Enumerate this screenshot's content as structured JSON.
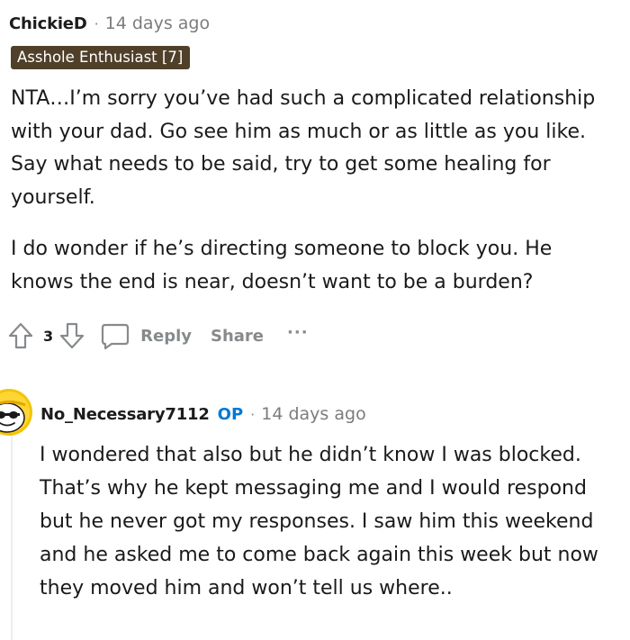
{
  "comment": {
    "username": "ChickieD",
    "separator": "·",
    "timestamp": "14 days ago",
    "flair": "Asshole Enthusiast [7]",
    "paragraphs": [
      "NTA…I’m sorry you’ve had such a complicated relationship with your dad. Go see him as much or as little as you like. Say what needs to be said, try to get some healing for yourself.",
      "I do wonder if he’s directing someone to block you. He knows the end is near, doesn’t want to be a burden?"
    ],
    "vote_count": "3",
    "reply_label": "Reply",
    "share_label": "Share",
    "more_label": "···"
  },
  "reply": {
    "username": "No_Necessary7112",
    "op_label": "OP",
    "separator": "·",
    "timestamp": "14 days ago",
    "text": "I wondered that also but he didn’t know I was blocked. That’s why he kept messaging me and I would respond but he never got my responses. I saw him this weekend and he asked me to come back again this week but now they moved him and won’t tell us where.."
  },
  "colors": {
    "flair_bg": "#50402a",
    "op_blue": "#0079d3",
    "muted_gray": "#878a8c",
    "avatar_yellow": "#f5c400"
  },
  "icons": {
    "upvote": "upvote-arrow-icon",
    "downvote": "downvote-arrow-icon",
    "reply": "comment-bubble-icon",
    "more": "more-dots-icon",
    "avatar": "snoo-avatar-icon"
  }
}
